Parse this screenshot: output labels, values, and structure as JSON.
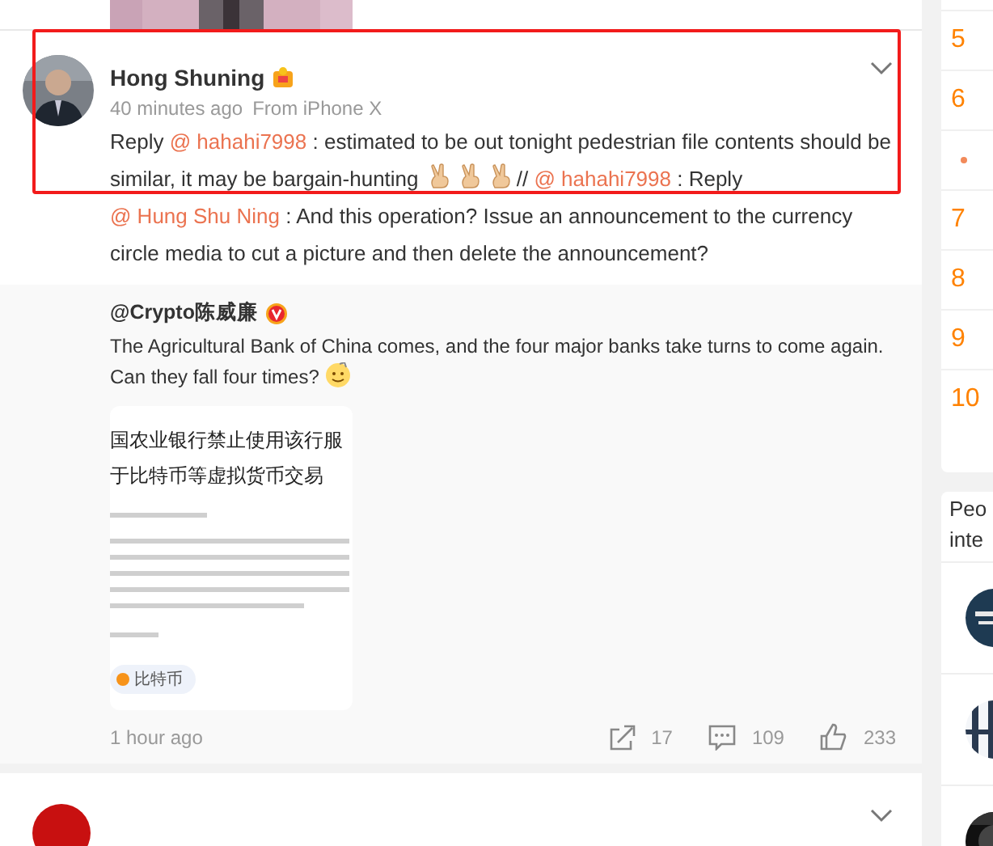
{
  "top_picture": {
    "kind": "picture"
  },
  "comment": {
    "author": "Hong Shuning",
    "time": "40 minutes ago",
    "source": "From iPhone X",
    "segments": [
      {
        "kind": "text",
        "text": "Reply "
      },
      {
        "kind": "mention",
        "text": "@ hahahi7998"
      },
      {
        "kind": "text",
        "text": " : estimated to be out tonight pedestrian file contents should be similar, it may be bargain-hunting "
      },
      {
        "kind": "emoji"
      },
      {
        "kind": "emoji"
      },
      {
        "kind": "emoji"
      },
      {
        "kind": "text",
        "text": "// "
      },
      {
        "kind": "mention",
        "text": "@ hahahi7998"
      },
      {
        "kind": "text",
        "text": " : Reply "
      },
      {
        "kind": "mention",
        "text": "@ Hung Shu Ning"
      },
      {
        "kind": "text",
        "text": " : And this operation? Issue an announcement to the currency circle media to cut a picture and then delete the announcement?"
      }
    ]
  },
  "repost": {
    "author": "@Crypto陈威廉",
    "text": "The Agricultural Bank of China comes, and the four major banks take turns to come again. Can they fall four times?",
    "attachment": {
      "headline": [
        "国农业银行禁止使用该行服",
        "于比特币等虚拟货币交易"
      ],
      "tag": "比特币"
    }
  },
  "footer": {
    "time": "1 hour ago",
    "reposts": "17",
    "comments": "109",
    "likes": "233"
  },
  "rank": {
    "items": [
      {
        "kind": "number",
        "text": "5"
      },
      {
        "kind": "number",
        "text": "6"
      },
      {
        "kind": "dot"
      },
      {
        "kind": "number",
        "text": "7"
      },
      {
        "kind": "number",
        "text": "8"
      },
      {
        "kind": "number",
        "text": "9"
      },
      {
        "kind": "number",
        "text": "10"
      }
    ]
  },
  "people": {
    "title_lines": [
      "Peo",
      "inte"
    ],
    "avatars": [
      {
        "kind": "picture"
      },
      {
        "kind": "picture"
      },
      {
        "kind": "picture"
      }
    ]
  }
}
